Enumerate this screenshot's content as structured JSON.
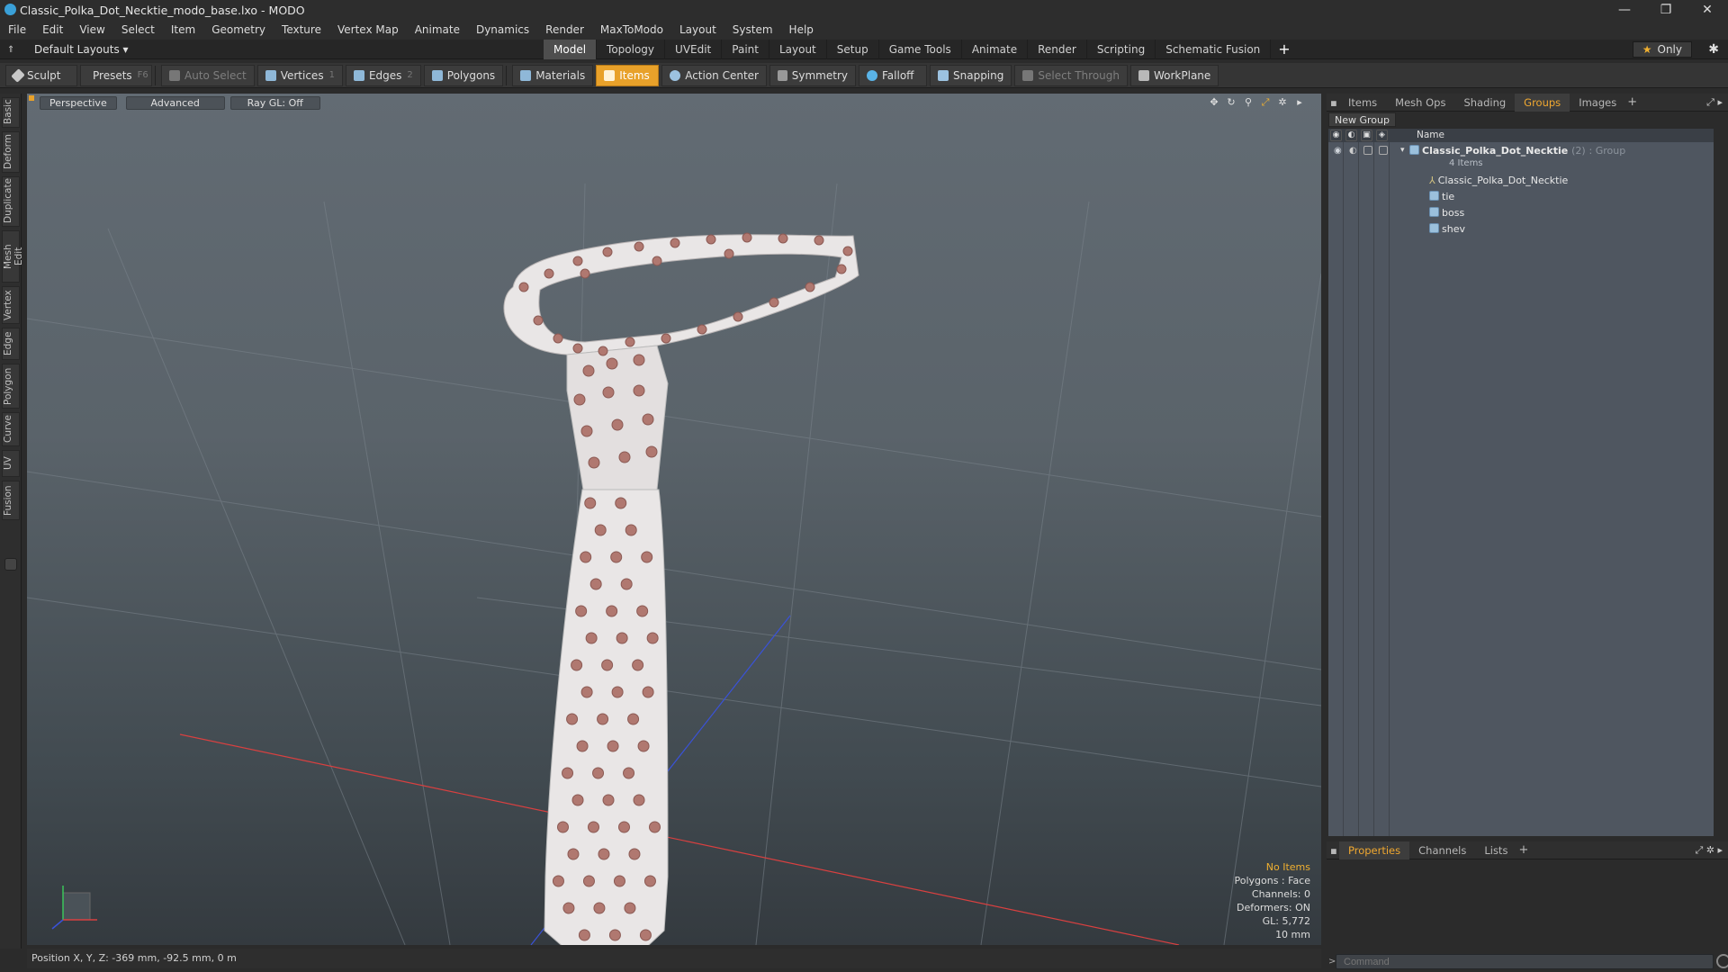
{
  "window": {
    "title": "Classic_Polka_Dot_Necktie_modo_base.lxo - MODO",
    "controls": [
      "—",
      "❐",
      "✕"
    ]
  },
  "menu": [
    "File",
    "Edit",
    "View",
    "Select",
    "Item",
    "Geometry",
    "Texture",
    "Vertex Map",
    "Animate",
    "Dynamics",
    "Render",
    "MaxToModo",
    "Layout",
    "System",
    "Help"
  ],
  "layoutbar": {
    "layouts_label": "Default Layouts ▾",
    "tabs": [
      "Model",
      "Topology",
      "UVEdit",
      "Paint",
      "Layout",
      "Setup",
      "Game Tools",
      "Animate",
      "Render",
      "Scripting",
      "Schematic Fusion"
    ],
    "active_tab": "Model",
    "only_label": "Only"
  },
  "toolbar": {
    "sculpt": "Sculpt",
    "presets": "Presets",
    "presets_key": "F6",
    "auto_select": "Auto Select",
    "vertices": "Vertices",
    "vertices_key": "1",
    "edges": "Edges",
    "edges_key": "2",
    "polygons": "Polygons",
    "materials": "Materials",
    "items": "Items",
    "action_center": "Action Center",
    "symmetry": "Symmetry",
    "falloff": "Falloff",
    "snapping": "Snapping",
    "select_through": "Select Through",
    "workplane": "WorkPlane"
  },
  "left_tabs": [
    "Basic",
    "Deform",
    "Duplicate",
    "Mesh Edit",
    "Vertex",
    "Edge",
    "Polygon",
    "Curve",
    "UV",
    "Fusion"
  ],
  "viewport": {
    "perspective": "Perspective",
    "advanced": "Advanced",
    "raygl": "Ray GL: Off",
    "stats": {
      "selection": "No Items",
      "polygons": "Polygons : Face",
      "channels": "Channels: 0",
      "deformers": "Deformers: ON",
      "gl": "GL: 5,772",
      "scale": "10 mm"
    },
    "colors": {
      "dot": "#b07870",
      "fabric": "#e9e6e6",
      "x_axis": "#d94040",
      "y_axis": "#3a52d8"
    }
  },
  "statusbar": {
    "position": "Position X, Y, Z:  -369 mm, -92.5 mm, 0 m"
  },
  "right_panel": {
    "tabs": [
      "Items",
      "Mesh Ops",
      "Shading",
      "Groups",
      "Images"
    ],
    "active_tab": "Groups",
    "new_group": "New Group",
    "column_name": "Name",
    "group": {
      "name": "Classic_Polka_Dot_Necktie",
      "count": "(2)",
      "kind": ": Group",
      "subtitle": "4 Items"
    },
    "items": [
      "Classic_Polka_Dot_Necktie",
      "tie",
      "boss",
      "shev"
    ],
    "bottom_tabs": [
      "Properties",
      "Channels",
      "Lists"
    ],
    "command_placeholder": "Command"
  }
}
